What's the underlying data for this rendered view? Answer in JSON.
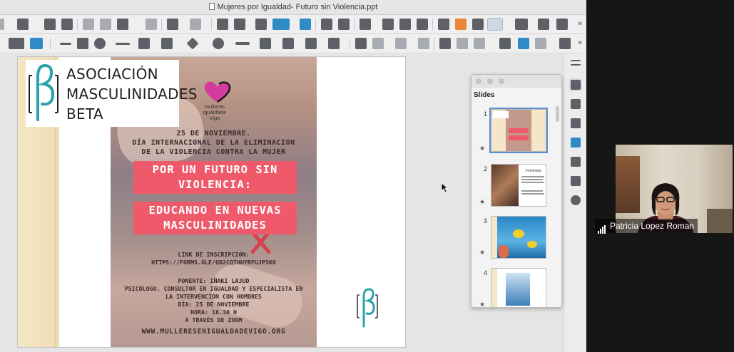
{
  "window": {
    "title": "Mujeres por Igualdad- Futuro sin Violencia.ppt"
  },
  "toolbar": {
    "more_glyph": "»"
  },
  "slide": {
    "logo": {
      "lines": [
        "ASOCIACIÓN",
        "MASCULINIDADES",
        "BETA"
      ]
    },
    "partner_logo": {
      "lines": [
        "mulleres",
        "igualdade",
        "Vigo"
      ]
    },
    "date_lines": [
      "25 DE NOVIEMBRE.",
      "DÍA INTERNACIONAL DE LA ELIMINACION",
      "DE LA VIOLENCIA CONTRA LA MUJER"
    ],
    "banner1_lines": [
      "POR UN FUTURO SIN",
      "VIOLENCIA:"
    ],
    "banner2_lines": [
      "EDUCANDO EN NUEVAS",
      "MASCULINIDADES"
    ],
    "link_lines": [
      "LINK DE INSCRIPCIÓN:",
      "HTTPS://FORMS.GLE/QD2CQTHUYRFUJPSK6"
    ],
    "speaker_lines": [
      "PONENTE: IÑAKI LAJUD",
      "PSICÓLOGO, CONSULTOR EN IGUALDAD Y ESPECIALISTA EN",
      "LA INTERVENCIÓN CON HOMBRES",
      "DÍA: 25 DE NOVIEMBRE",
      "HORA: 16.30 H",
      "A TRAVÉS DE ZOOM"
    ],
    "website": "WWW.MULLERESENIGUALDADEVIGO.ORG"
  },
  "slides_panel": {
    "title": "Slides",
    "thumbnails": [
      {
        "number": "1"
      },
      {
        "number": "2",
        "heading": "Feminista"
      },
      {
        "number": "3"
      },
      {
        "number": "4"
      }
    ]
  },
  "video": {
    "participant_name": "Patricia Lopez Roman"
  },
  "colors": {
    "banner": "#ef5a6b",
    "beta_teal": "#2aa3a8",
    "heart_magenta": "#d63a9c",
    "selection": "#5b8fd0"
  }
}
